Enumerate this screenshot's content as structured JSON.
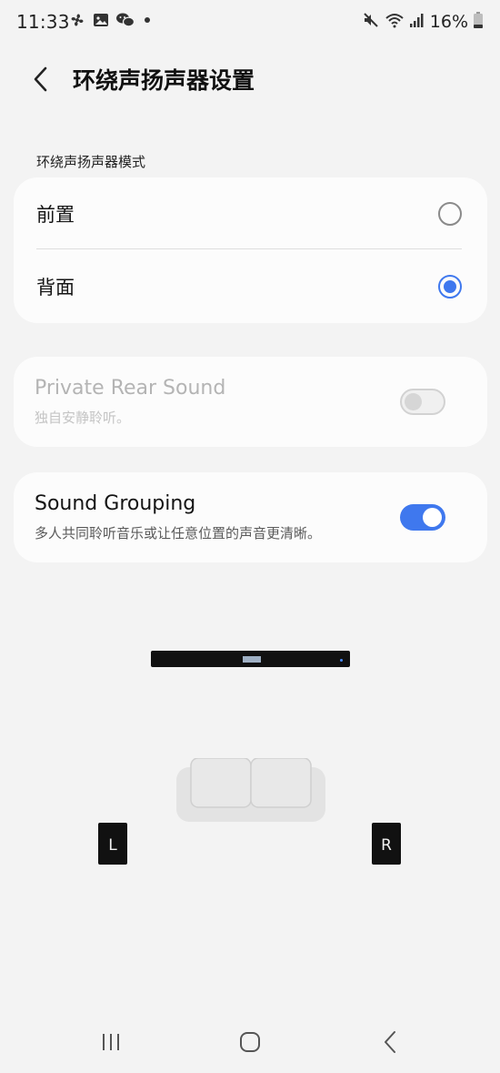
{
  "status_bar": {
    "time": "11:33",
    "battery": "16%",
    "left_icons": [
      "fan-icon",
      "gallery-icon",
      "wechat-icon",
      "notification-dot-icon"
    ],
    "right_icons": [
      "mute-icon",
      "wifi-icon",
      "signal-icon",
      "battery-icon"
    ]
  },
  "header": {
    "title": "环绕声扬声器设置"
  },
  "mode_section": {
    "label": "环绕声扬声器模式",
    "options": [
      {
        "label": "前置",
        "selected": false
      },
      {
        "label": "背面",
        "selected": true
      }
    ]
  },
  "private_rear_sound": {
    "title": "Private Rear Sound",
    "subtitle": "独自安静聆听。",
    "enabled": false,
    "on": false
  },
  "sound_grouping": {
    "title": "Sound Grouping",
    "subtitle": "多人共同聆听音乐或让任意位置的声音更清晰。",
    "enabled": true,
    "on": true
  },
  "diagram": {
    "left_speaker": "L",
    "right_speaker": "R"
  },
  "colors": {
    "accent": "#3f78ee",
    "background": "#f3f3f3",
    "card": "#fcfcfc"
  },
  "nav": {
    "icons": [
      "recent-apps-icon",
      "home-icon",
      "back-icon"
    ]
  }
}
